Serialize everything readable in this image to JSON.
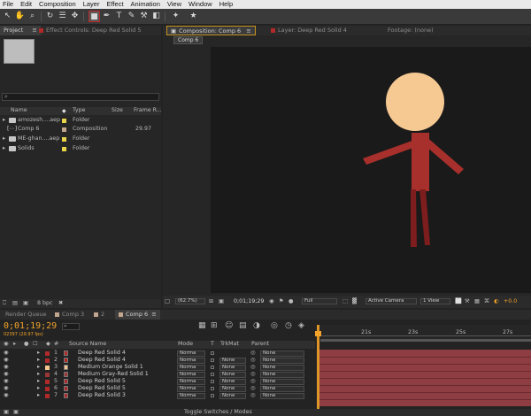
{
  "menu": [
    "File",
    "Edit",
    "Composition",
    "Layer",
    "Effect",
    "Animation",
    "View",
    "Window",
    "Help"
  ],
  "toolbar_icons": [
    "selection-tool",
    "hand-tool",
    "zoom-tool",
    "rotate-tool",
    "orbit-camera-tool",
    "pan-behind-tool",
    "rectangle-tool",
    "pen-tool",
    "type-tool",
    "brush-tool",
    "clone-stamp-tool",
    "eraser-tool",
    "roto-brush-tool",
    "puppet-pin-tool"
  ],
  "annotation": {
    "text": "Q!"
  },
  "project": {
    "tab_label": "Project",
    "effect_controls_label": "Effect Controls: Deep Red Solid 5",
    "search_placeholder": "⌕",
    "columns": {
      "name": "Name",
      "type": "Type",
      "size": "Size",
      "frame_rate": "Frame R..."
    },
    "items": [
      {
        "name": "amozesh....aep",
        "type": "Folder",
        "size": "",
        "fr": "",
        "color": "#e8d44a"
      },
      {
        "name": "Comp 6",
        "type": "Composition",
        "size": "",
        "fr": "29.97",
        "color": "#c3a68e"
      },
      {
        "name": "ME-ghan....aep",
        "type": "Folder",
        "size": "",
        "fr": "",
        "color": "#e8d44a"
      },
      {
        "name": "Solids",
        "type": "Folder",
        "size": "",
        "fr": "",
        "color": "#e8d44a"
      }
    ],
    "bpc": "8 bpc"
  },
  "composition": {
    "tab_label": "Composition: Comp 6",
    "layer_tab": "Layer: Deep Red Solid 4",
    "footage_tab": "Footage: (none)",
    "breadcrumb": "Comp 6",
    "zoom": "(62.7%)",
    "timecode": "0;01;19;29",
    "resolution": "Full",
    "camera": "Active Camera",
    "views": "1 View",
    "exposure": "+0.0"
  },
  "timeline": {
    "tabs": [
      "Render Queue",
      "Comp 3",
      "2",
      "Comp 6"
    ],
    "timecode": "0;01;19;29",
    "frame_info": "02397 (29.97 fps)",
    "columns": {
      "source": "Source Name",
      "mode": "Mode",
      "t": "T",
      "trkmat": "TrkMat",
      "parent": "Parent"
    },
    "ruler": [
      "21s",
      "23s",
      "25s",
      "27s"
    ],
    "layers": [
      {
        "num": "1",
        "name": "Deep Red Solid 4",
        "color": "#b02a2a",
        "mode": "Norma",
        "trk": "",
        "parent": "None"
      },
      {
        "num": "2",
        "name": "Deep Red Solid 4",
        "color": "#b02a2a",
        "mode": "Norma",
        "trk": "None",
        "parent": "None"
      },
      {
        "num": "3",
        "name": "Medium Orange Solid 1",
        "color": "#f4c690",
        "mode": "Norma",
        "trk": "None",
        "parent": "None"
      },
      {
        "num": "4",
        "name": "Medium Gray-Red Solid 1",
        "color": "#9c3535",
        "mode": "Norma",
        "trk": "None",
        "parent": "None"
      },
      {
        "num": "5",
        "name": "Deep Red Solid 5",
        "color": "#b02a2a",
        "mode": "Norma",
        "trk": "None",
        "parent": "None"
      },
      {
        "num": "6",
        "name": "Deep Red Solid 5",
        "color": "#b02a2a",
        "mode": "Norma",
        "trk": "None",
        "parent": "None"
      },
      {
        "num": "7",
        "name": "Deep Red Solid 3",
        "color": "#b02a2a",
        "mode": "Norma",
        "trk": "None",
        "parent": "None"
      }
    ],
    "toggle_label": "Toggle Switches / Modes"
  },
  "colors": {
    "accent": "#f4a32a",
    "head": "#f6c993",
    "body": "#a8302c",
    "legs": "#7d1d1d",
    "track": "#8e3d43"
  }
}
